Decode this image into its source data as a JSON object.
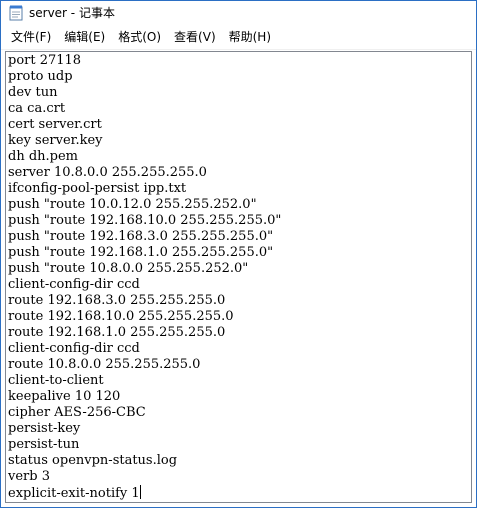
{
  "window": {
    "title": "server - 记事本",
    "app_icon": "notepad-icon"
  },
  "menu": {
    "items": [
      {
        "label": "文件(F)"
      },
      {
        "label": "编辑(E)"
      },
      {
        "label": "格式(O)"
      },
      {
        "label": "查看(V)"
      },
      {
        "label": "帮助(H)"
      }
    ]
  },
  "editor": {
    "caret_line": 27,
    "lines": [
      "port 27118",
      "proto udp",
      "dev tun",
      "ca ca.crt",
      "cert server.crt",
      "key server.key",
      "dh dh.pem",
      "server 10.8.0.0 255.255.255.0",
      "ifconfig-pool-persist ipp.txt",
      "push \"route 10.0.12.0 255.255.252.0\"",
      "push \"route 192.168.10.0 255.255.255.0\"",
      "push \"route 192.168.3.0 255.255.255.0\"",
      "push \"route 192.168.1.0 255.255.255.0\"",
      "push \"route 10.8.0.0 255.255.252.0\"",
      "client-config-dir ccd",
      "route 192.168.3.0 255.255.255.0",
      "route 192.168.10.0 255.255.255.0",
      "route 192.168.1.0 255.255.255.0",
      "client-config-dir ccd",
      "route 10.8.0.0 255.255.255.0",
      "client-to-client",
      "keepalive 10 120",
      "cipher AES-256-CBC",
      "persist-key",
      "persist-tun",
      "status openvpn-status.log",
      "verb 3",
      "explicit-exit-notify 1"
    ]
  }
}
